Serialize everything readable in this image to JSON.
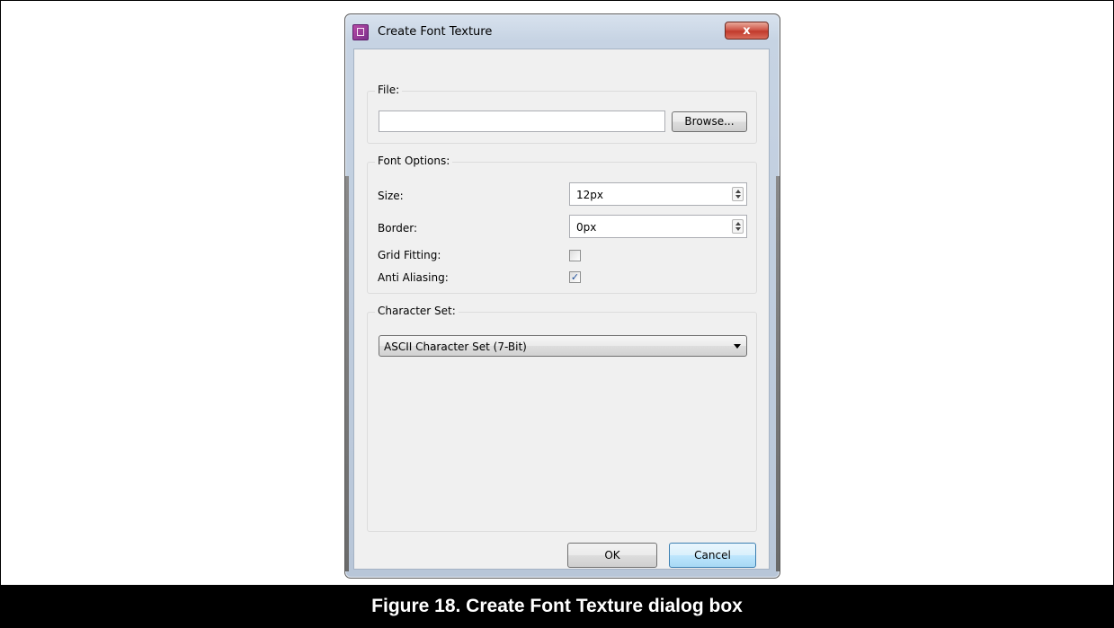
{
  "window": {
    "title": "Create Font Texture",
    "close_glyph": "x"
  },
  "file_group": {
    "label": "File:",
    "path_value": "",
    "browse_label": "Browse..."
  },
  "font_options": {
    "label": "Font Options:",
    "size": {
      "label": "Size:",
      "value": "12px"
    },
    "border": {
      "label": "Border:",
      "value": "0px"
    },
    "grid_fitting": {
      "label": "Grid Fitting:",
      "checked": false,
      "mark": ""
    },
    "anti_aliasing": {
      "label": "Anti Aliasing:",
      "checked": true,
      "mark": "✓"
    }
  },
  "character_set": {
    "label": "Character Set:",
    "selected": "ASCII Character Set (7-Bit)"
  },
  "buttons": {
    "ok_label": "OK",
    "cancel_label": "Cancel"
  },
  "caption": "Figure 18. Create Font Texture dialog box"
}
